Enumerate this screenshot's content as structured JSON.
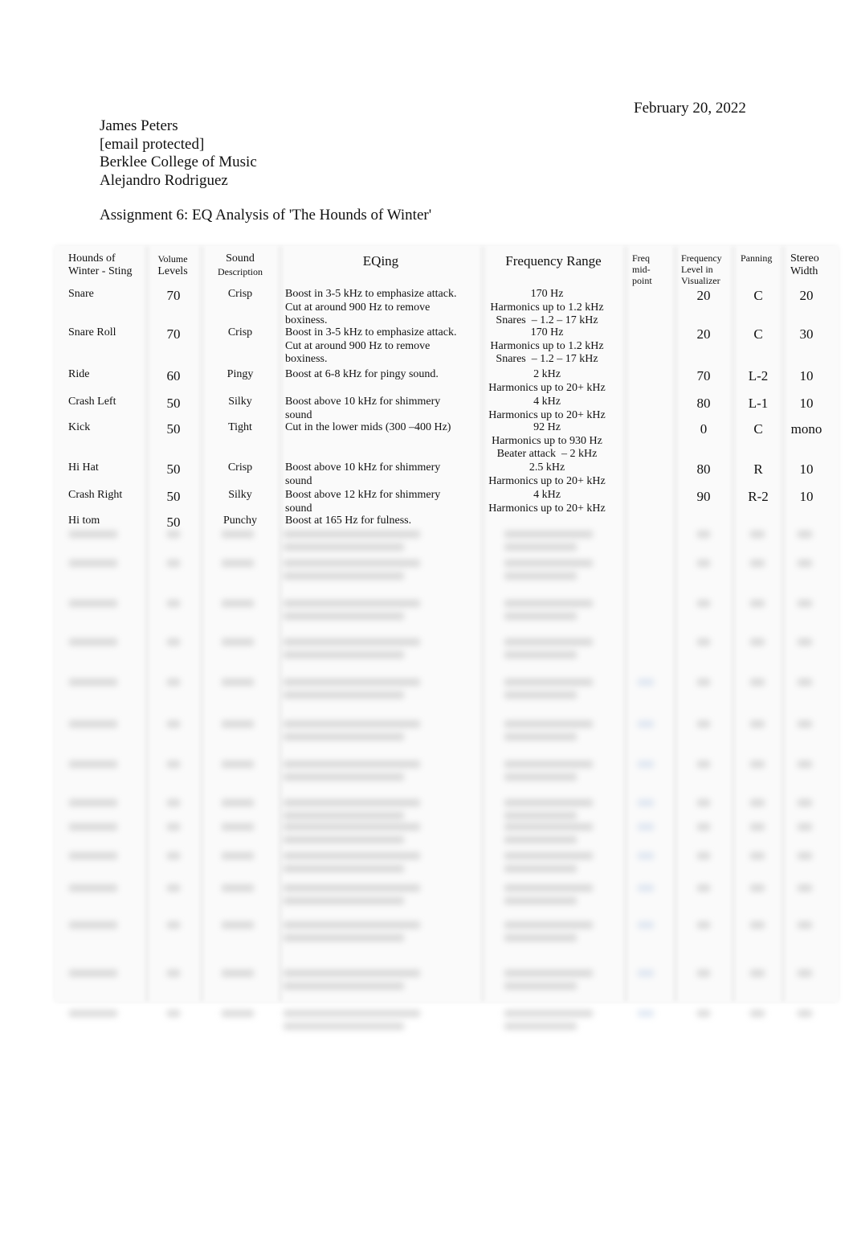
{
  "document": {
    "date": "February 20, 2022",
    "author": "James Peters",
    "email": "[email protected]",
    "institution": "Berklee College of Music",
    "instructor": "Alejandro Rodriguez",
    "title": "Assignment 6: EQ Analysis of 'The Hounds of Winter'"
  },
  "table": {
    "headers": {
      "instrument": [
        "Hounds of",
        "Winter - Sting"
      ],
      "volume": [
        "Volume",
        "Levels"
      ],
      "sound": [
        "Sound",
        "Description"
      ],
      "eq": "EQing",
      "freq_range": "Frequency Range",
      "midpoint": [
        "Freq",
        "mid-",
        "point"
      ],
      "visualizer": [
        "Frequency",
        "Level in",
        "Visualizer"
      ],
      "panning": "Panning",
      "stereo": [
        "Stereo",
        "Width"
      ]
    },
    "rows": [
      {
        "instrument": "Snare",
        "volume": "70",
        "sound": "Crisp",
        "eq": [
          "Boost in 3-5 kHz to emphasize attack.",
          "Cut at around 900 Hz to remove",
          "boxiness."
        ],
        "freq": [
          "170 Hz",
          "Harmonics up to 1.2 kHz",
          "Snares  – 1.2 – 17 kHz"
        ],
        "visualizer": "20",
        "panning": "C",
        "stereo": "20"
      },
      {
        "instrument": "Snare Roll",
        "volume": "70",
        "sound": "Crisp",
        "eq": [
          "Boost in 3-5 kHz to emphasize attack.",
          "Cut at around 900 Hz to remove",
          "boxiness."
        ],
        "freq": [
          "170 Hz",
          "Harmonics up to 1.2 kHz",
          "Snares  – 1.2 – 17 kHz"
        ],
        "visualizer": "20",
        "panning": "C",
        "stereo": "30"
      },
      {
        "instrument": "Ride",
        "volume": "60",
        "sound": "Pingy",
        "eq": [
          "Boost at 6-8 kHz for pingy sound."
        ],
        "freq": [
          "2 kHz",
          "Harmonics up to 20+ kHz"
        ],
        "visualizer": "70",
        "panning": "L-2",
        "stereo": "10"
      },
      {
        "instrument": "Crash Left",
        "volume": "50",
        "sound": "Silky",
        "eq": [
          "Boost above 10 kHz for shimmery",
          "sound"
        ],
        "freq": [
          "4 kHz",
          "Harmonics up to 20+ kHz"
        ],
        "visualizer": "80",
        "panning": "L-1",
        "stereo": "10"
      },
      {
        "instrument": "Kick",
        "volume": "50",
        "sound": "Tight",
        "eq": [
          "Cut in the lower mids (300   –400 Hz)"
        ],
        "freq": [
          "92 Hz",
          "Harmonics up to 930 Hz",
          "Beater attack  – 2 kHz"
        ],
        "visualizer": "0",
        "panning": "C",
        "stereo": "mono"
      },
      {
        "instrument": "Hi Hat",
        "volume": "50",
        "sound": "Crisp",
        "eq": [
          "Boost above 10 kHz for shimmery",
          "sound"
        ],
        "freq": [
          "2.5 kHz",
          "Harmonics up to 20+ kHz"
        ],
        "visualizer": "80",
        "panning": "R",
        "stereo": "10"
      },
      {
        "instrument": "Crash Right",
        "volume": "50",
        "sound": "Silky",
        "eq": [
          "Boost above 12 kHz for shimmery",
          "sound"
        ],
        "freq": [
          "4 kHz",
          "Harmonics up to 20+ kHz"
        ],
        "visualizer": "90",
        "panning": "R-2",
        "stereo": "10"
      },
      {
        "instrument": "Hi tom",
        "volume": "50",
        "sound": "Punchy",
        "eq": [
          "Boost at 165 Hz for fulness."
        ],
        "freq": [],
        "visualizer": "",
        "panning": "",
        "stereo": ""
      }
    ]
  }
}
